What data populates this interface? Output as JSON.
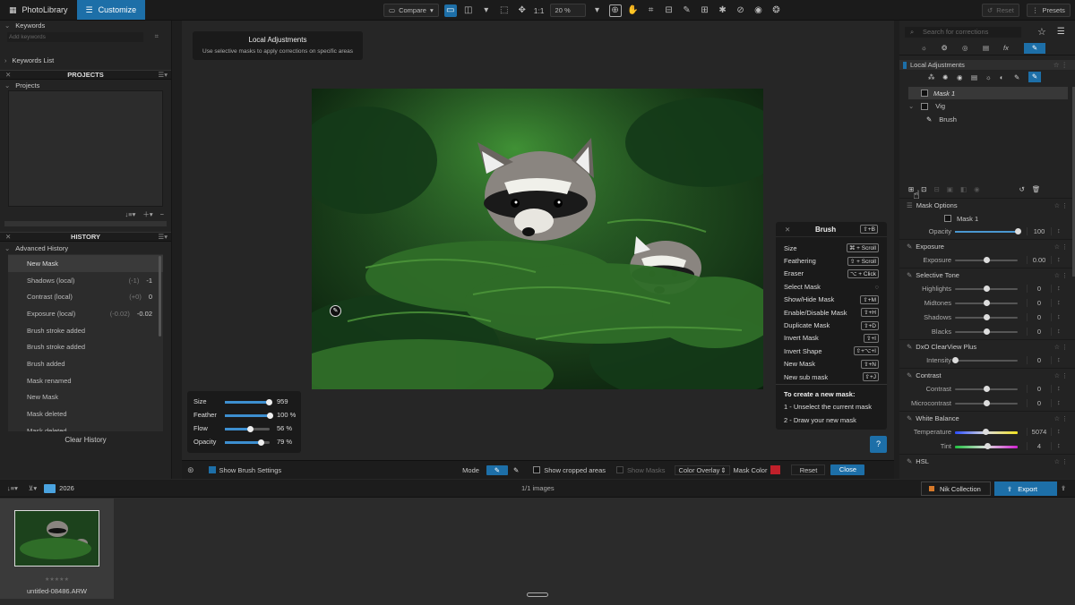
{
  "topbar": {
    "tabs": [
      "PhotoLibrary",
      "Customize"
    ],
    "compare": "Compare",
    "ratio": "1:1",
    "zoom": "20 %",
    "reset": "Reset",
    "presets": "Presets"
  },
  "left": {
    "keywords": "Keywords",
    "add_keyword": "Add keywords",
    "keywords_list": "Keywords List",
    "projects_header": "PROJECTS",
    "projects": "Projects",
    "history_header": "HISTORY",
    "advanced_history": "Advanced History",
    "clear_history": "Clear History",
    "history_items": [
      {
        "label": "New Mask",
        "prev": "",
        "val": ""
      },
      {
        "label": "Shadows (local)",
        "prev": "(-1)",
        "val": "-1"
      },
      {
        "label": "Contrast (local)",
        "prev": "(+0)",
        "val": "0"
      },
      {
        "label": "Exposure (local)",
        "prev": "(-0.02)",
        "val": "-0.02"
      },
      {
        "label": "Brush stroke added",
        "prev": "",
        "val": ""
      },
      {
        "label": "Brush stroke added",
        "prev": "",
        "val": ""
      },
      {
        "label": "Brush added",
        "prev": "",
        "val": ""
      },
      {
        "label": "Mask renamed",
        "prev": "",
        "val": ""
      },
      {
        "label": "New Mask",
        "prev": "",
        "val": ""
      },
      {
        "label": "Mask deleted",
        "prev": "",
        "val": ""
      },
      {
        "label": "Mask deleted",
        "prev": "",
        "val": ""
      }
    ]
  },
  "tooltip": {
    "title": "Local Adjustments",
    "text": "Use selective masks to apply corrections on specific areas"
  },
  "brush_settings": {
    "rows": [
      {
        "label": "Size",
        "value": "959",
        "pos": 0.97
      },
      {
        "label": "Feather",
        "value": "100 %",
        "pos": 1.0
      },
      {
        "label": "Flow",
        "value": "56 %",
        "pos": 0.56
      },
      {
        "label": "Opacity",
        "value": "79 %",
        "pos": 0.79
      }
    ]
  },
  "brush_popup": {
    "title": "Brush",
    "shortcut": "⇧+B",
    "rows": [
      {
        "label": "Size",
        "key": "⌘ + Scroll"
      },
      {
        "label": "Feathering",
        "key": "⇧ + Scroll"
      },
      {
        "label": "Eraser",
        "key": "⌥ + Click"
      },
      {
        "label": "Select Mask",
        "key": ""
      },
      {
        "label": "Show/Hide Mask",
        "key": "⇧+M"
      },
      {
        "label": "Enable/Disable Mask",
        "key": "⇧+H"
      },
      {
        "label": "Duplicate Mask",
        "key": "⇧+D"
      },
      {
        "label": "Invert Mask",
        "key": "⇧+I"
      },
      {
        "label": "Invert Shape",
        "key": "⇧+⌥+I"
      },
      {
        "label": "New Mask",
        "key": "⇧+N"
      },
      {
        "label": "New sub mask",
        "key": "⇧+J"
      }
    ],
    "howto_title": "To create a new mask:",
    "step1": "1 - Unselect the current mask",
    "step2": "2 - Draw your new mask",
    "help": "?"
  },
  "viewer_bottom": {
    "show_brush_settings": "Show Brush Settings",
    "mode": "Mode",
    "show_cropped": "Show cropped areas",
    "show_masks": "Show Masks",
    "overlay": "Color Overlay",
    "mask_color": "Mask Color",
    "mask_color_hex": "#c0202a",
    "reset": "Reset",
    "close": "Close"
  },
  "right": {
    "search_placeholder": "Search for corrections",
    "local_adj": "Local Adjustments",
    "masks": [
      {
        "name": "Mask 1",
        "level": 0
      },
      {
        "name": "Vig",
        "level": 0
      },
      {
        "name": "Brush",
        "level": 1
      }
    ],
    "mask_options": "Mask Options",
    "mask1": "Mask 1",
    "sections": [
      {
        "title": "",
        "rows": [
          {
            "label": "Opacity",
            "value": "100",
            "pos": 1.0,
            "type": "blue"
          }
        ]
      },
      {
        "title": "Exposure",
        "rows": [
          {
            "label": "Exposure",
            "value": "0.00",
            "pos": 0.5
          }
        ]
      },
      {
        "title": "Selective Tone",
        "rows": [
          {
            "label": "Highlights",
            "value": "0",
            "pos": 0.5
          },
          {
            "label": "Midtones",
            "value": "0",
            "pos": 0.5
          },
          {
            "label": "Shadows",
            "value": "0",
            "pos": 0.5
          },
          {
            "label": "Blacks",
            "value": "0",
            "pos": 0.5
          }
        ]
      },
      {
        "title": "DxO ClearView Plus",
        "rows": [
          {
            "label": "Intensity",
            "value": "0",
            "pos": 0.0
          }
        ]
      },
      {
        "title": "Contrast",
        "rows": [
          {
            "label": "Contrast",
            "value": "0",
            "pos": 0.5
          },
          {
            "label": "Microcontrast",
            "value": "0",
            "pos": 0.5
          }
        ]
      },
      {
        "title": "White Balance",
        "rows": [
          {
            "label": "Temperature",
            "value": "5074",
            "pos": 0.48,
            "type": "temp"
          },
          {
            "label": "Tint",
            "value": "4",
            "pos": 0.52,
            "type": "tint"
          }
        ]
      },
      {
        "title": "HSL",
        "rows": []
      }
    ]
  },
  "filmbar": {
    "folder": "2026",
    "count": "1/1 images",
    "nik": "Nik Collection",
    "export": "Export"
  },
  "thumb": {
    "filename": "untitled-08486.ARW",
    "stars": "★★★★★"
  }
}
